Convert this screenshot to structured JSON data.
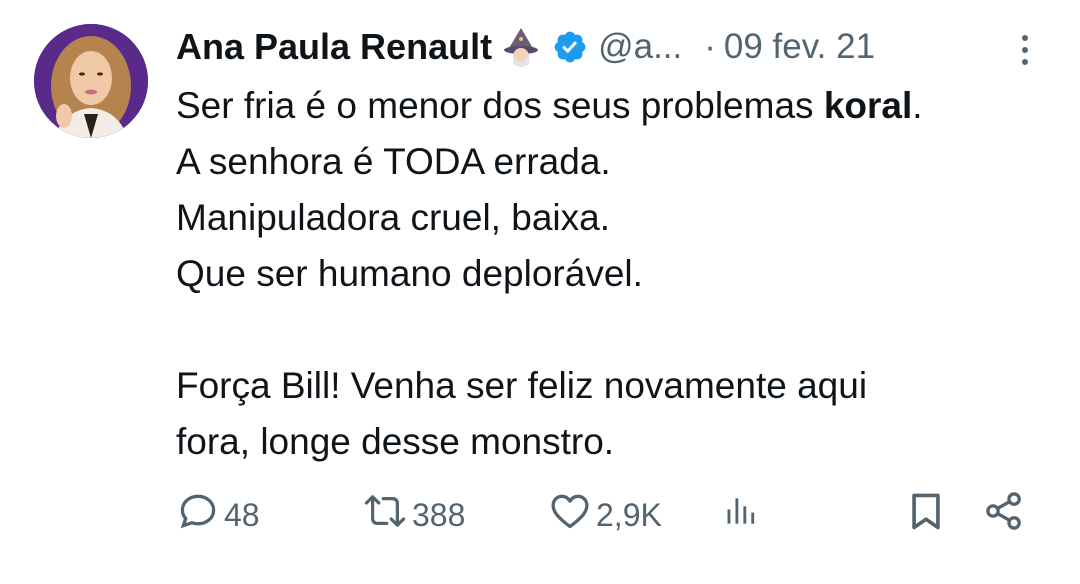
{
  "tweet": {
    "author_name": "Ana Paula Renault",
    "author_emoji_icon": "woman-mage-emoji",
    "verified_icon": "verified-badge-icon",
    "handle": "@a...",
    "dot": "·",
    "date": "09 fev. 21",
    "body": {
      "line1_prefix": "Ser fria é o menor dos seus problemas ",
      "line1_bold": "koral",
      "line1_suffix": ".",
      "line2": "A senhora é TODA errada.",
      "line3": "Manipuladora cruel, baixa.",
      "line4": "Que ser humano deplorável.",
      "line6": "Força Bill! Venha ser feliz novamente aqui",
      "line7": "fora, longe desse monstro."
    },
    "actions": {
      "reply_count": "48",
      "retweet_count": "388",
      "like_count": "2,9K"
    }
  },
  "colors": {
    "text": "#0f1419",
    "muted": "#536471",
    "verified": "#1d9bf0"
  }
}
